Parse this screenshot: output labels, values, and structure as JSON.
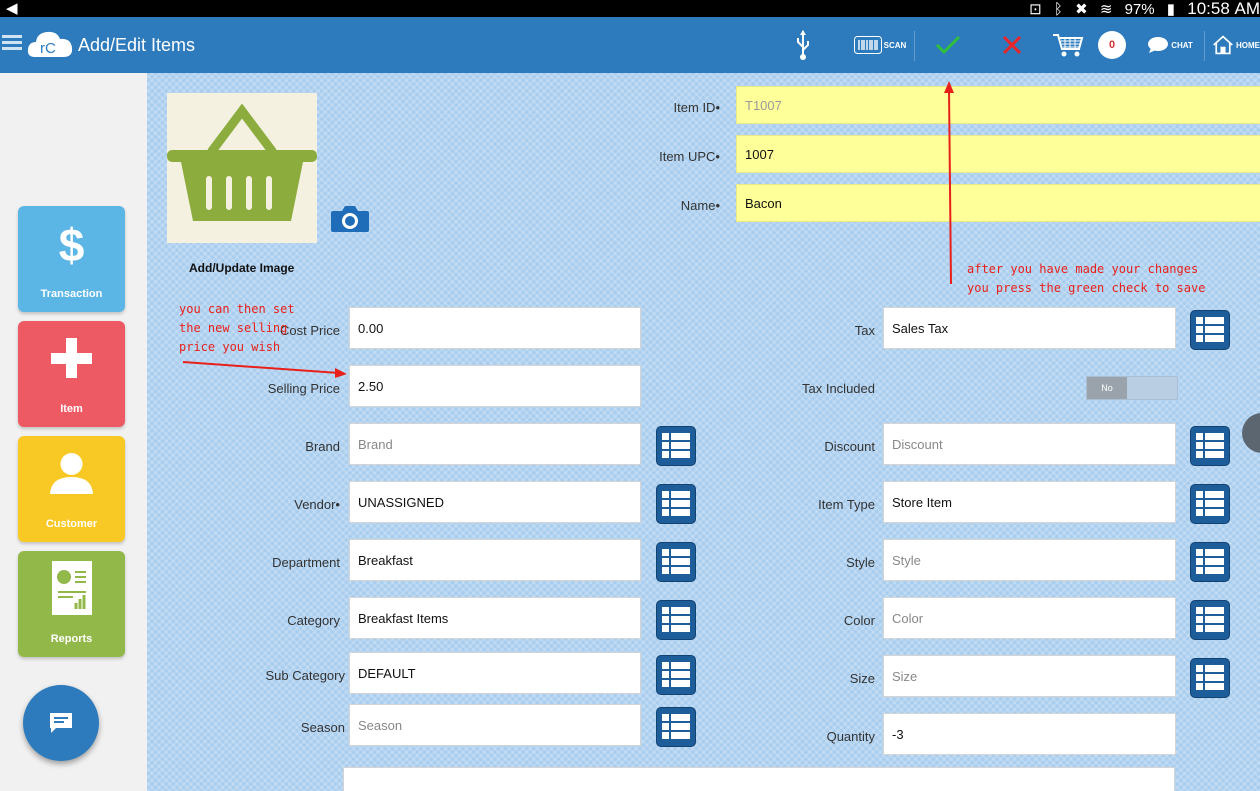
{
  "status_bar": {
    "battery": "97%",
    "time": "10:58 AM"
  },
  "header": {
    "title": "Add/Edit Items",
    "scan_label": "SCAN",
    "cart_count": "0",
    "chat_label": "CHAT",
    "home_label": "HOME"
  },
  "sidebar": {
    "tiles": [
      {
        "label": "Transaction",
        "color": "#5bb6e6",
        "icon": "dollar-icon"
      },
      {
        "label": "Item",
        "color": "#ee5a63",
        "icon": "plus-icon"
      },
      {
        "label": "Customer",
        "color": "#f8c824",
        "icon": "person-icon"
      },
      {
        "label": "Reports",
        "color": "#93b84a",
        "icon": "report-icon"
      }
    ]
  },
  "image": {
    "label": "Add/Update Image"
  },
  "top_fields": {
    "item_id": {
      "label": "Item ID•",
      "placeholder": "T1007"
    },
    "item_upc": {
      "label": "Item UPC•",
      "value": "1007"
    },
    "name": {
      "label": "Name•",
      "value": "Bacon"
    }
  },
  "left_fields": {
    "cost_price": {
      "label": "Cost Price",
      "value": "0.00"
    },
    "selling_price": {
      "label": "Selling Price",
      "value": "2.50"
    },
    "brand": {
      "label": "Brand",
      "placeholder": "Brand"
    },
    "vendor": {
      "label": "Vendor•",
      "value": "UNASSIGNED"
    },
    "department": {
      "label": "Department",
      "value": "Breakfast"
    },
    "category": {
      "label": "Category",
      "value": "Breakfast Items"
    },
    "sub_category": {
      "label": "Sub Category",
      "value": "DEFAULT"
    },
    "season": {
      "label": "Season",
      "placeholder": "Season"
    }
  },
  "right_fields": {
    "tax": {
      "label": "Tax",
      "value": "Sales Tax"
    },
    "tax_included": {
      "label": "Tax Included",
      "toggle": "No"
    },
    "discount": {
      "label": "Discount",
      "placeholder": "Discount"
    },
    "item_type": {
      "label": "Item Type",
      "value": "Store Item"
    },
    "style": {
      "label": "Style",
      "placeholder": "Style"
    },
    "color": {
      "label": "Color",
      "placeholder": "Color"
    },
    "size": {
      "label": "Size",
      "placeholder": "Size"
    },
    "quantity": {
      "label": "Quantity",
      "value": "-3"
    }
  },
  "annotations": {
    "price_note": "you can then set\nthe new selling\nprice you wish",
    "save_note": "after you have made your changes\nyou press the green check to save"
  },
  "colors": {
    "header": "#2d7bbd",
    "accept": "#2fbf3a",
    "cancel": "#e8262a",
    "annotation": "#e8201a",
    "list_button": "#1d5d99"
  }
}
